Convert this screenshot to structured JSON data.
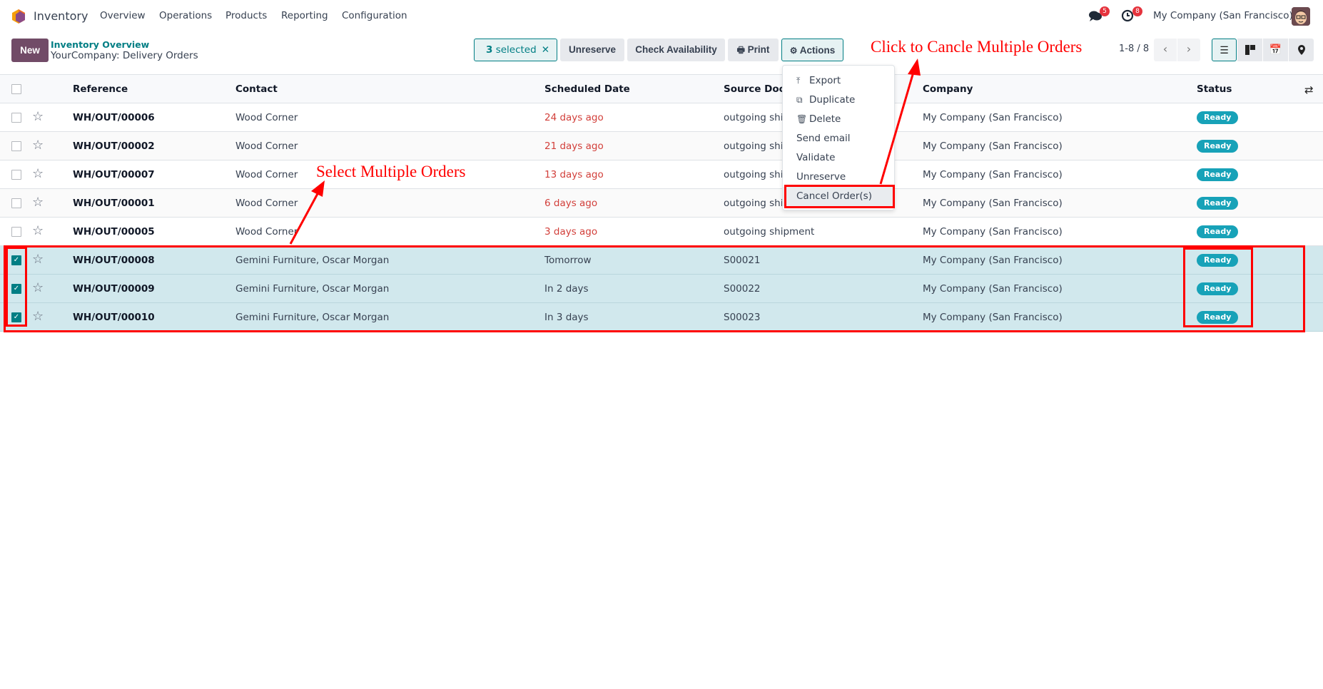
{
  "navbar": {
    "app_name": "Inventory",
    "menu": [
      "Overview",
      "Operations",
      "Products",
      "Reporting",
      "Configuration"
    ],
    "messages_icon": "chat-icon",
    "messages_count": "5",
    "activities_icon": "clock-icon",
    "activities_count": "8",
    "company": "My Company (San Francisco)",
    "avatar_icon": "user-avatar"
  },
  "control_panel": {
    "new_label": "New",
    "breadcrumb_parent": "Inventory Overview",
    "breadcrumb_current": "YourCompany: Delivery Orders",
    "selected_count": "3",
    "selected_suffix": " selected",
    "clear_selection_icon": "close-icon",
    "buttons": {
      "unreserve": "Unreserve",
      "check_availability": "Check Availability",
      "print": "Print",
      "actions": "Actions"
    },
    "pager": "1-8 / 8",
    "views": [
      "list-view",
      "kanban-view",
      "calendar-view",
      "map-view"
    ],
    "active_view": "list-view"
  },
  "actions_menu": {
    "items": [
      {
        "label": "Export",
        "icon": "upload-icon"
      },
      {
        "label": "Duplicate",
        "icon": "copy-icon"
      },
      {
        "label": "Delete",
        "icon": "trash-icon"
      },
      {
        "label": "Send email",
        "icon": ""
      },
      {
        "label": "Validate",
        "icon": ""
      },
      {
        "label": "Unreserve",
        "icon": ""
      },
      {
        "label": "Cancel Order(s)",
        "icon": ""
      }
    ],
    "highlighted": "Cancel Order(s)"
  },
  "table": {
    "columns": [
      "Reference",
      "Contact",
      "Scheduled Date",
      "Source Document",
      "Company",
      "Status"
    ],
    "columns_display": [
      "Reference",
      "Contact",
      "Scheduled Date",
      "Source Docu",
      "Company",
      "Status"
    ],
    "rows": [
      {
        "reference": "WH/OUT/00006",
        "contact": "Wood Corner",
        "scheduled": "24 days ago",
        "late": true,
        "source": "outgoing shipment",
        "source_visible": "outgoing shi",
        "company": "My Company (San Francisco)",
        "status": "Ready",
        "selected": false
      },
      {
        "reference": "WH/OUT/00002",
        "contact": "Wood Corner",
        "scheduled": "21 days ago",
        "late": true,
        "source": "outgoing shipment",
        "source_visible": "outgoing shi",
        "company": "My Company (San Francisco)",
        "status": "Ready",
        "selected": false
      },
      {
        "reference": "WH/OUT/00007",
        "contact": "Wood Corner",
        "scheduled": "13 days ago",
        "late": true,
        "source": "outgoing shipment",
        "source_visible": "outgoing shi",
        "company": "My Company (San Francisco)",
        "status": "Ready",
        "selected": false
      },
      {
        "reference": "WH/OUT/00001",
        "contact": "Wood Corner",
        "scheduled": "6 days ago",
        "late": true,
        "source": "outgoing shipment",
        "source_visible": "outgoing shi",
        "company": "My Company (San Francisco)",
        "status": "Ready",
        "selected": false
      },
      {
        "reference": "WH/OUT/00005",
        "contact": "Wood Corner",
        "scheduled": "3 days ago",
        "late": true,
        "source": "outgoing shipment",
        "source_visible": "outgoing shipment",
        "company": "My Company (San Francisco)",
        "status": "Ready",
        "selected": false
      },
      {
        "reference": "WH/OUT/00008",
        "contact": "Gemini Furniture, Oscar Morgan",
        "scheduled": "Tomorrow",
        "late": false,
        "source": "S00021",
        "source_visible": "S00021",
        "company": "My Company (San Francisco)",
        "status": "Ready",
        "selected": true
      },
      {
        "reference": "WH/OUT/00009",
        "contact": "Gemini Furniture, Oscar Morgan",
        "scheduled": "In 2 days",
        "late": false,
        "source": "S00022",
        "source_visible": "S00022",
        "company": "My Company (San Francisco)",
        "status": "Ready",
        "selected": true
      },
      {
        "reference": "WH/OUT/00010",
        "contact": "Gemini Furniture, Oscar Morgan",
        "scheduled": "In 3 days",
        "late": false,
        "source": "S00023",
        "source_visible": "S00023",
        "company": "My Company (San Francisco)",
        "status": "Ready",
        "selected": true
      }
    ]
  },
  "annotations": {
    "select_text": "Select Multiple Orders",
    "cancel_text": "Click to Cancle Multiple Orders",
    "color": "#ff0000"
  },
  "colors": {
    "brand": "#714b67",
    "accent": "#017e84",
    "late": "#d23f3a",
    "ready_badge": "#17a2b8",
    "selected_row": "#d1e8ed"
  }
}
